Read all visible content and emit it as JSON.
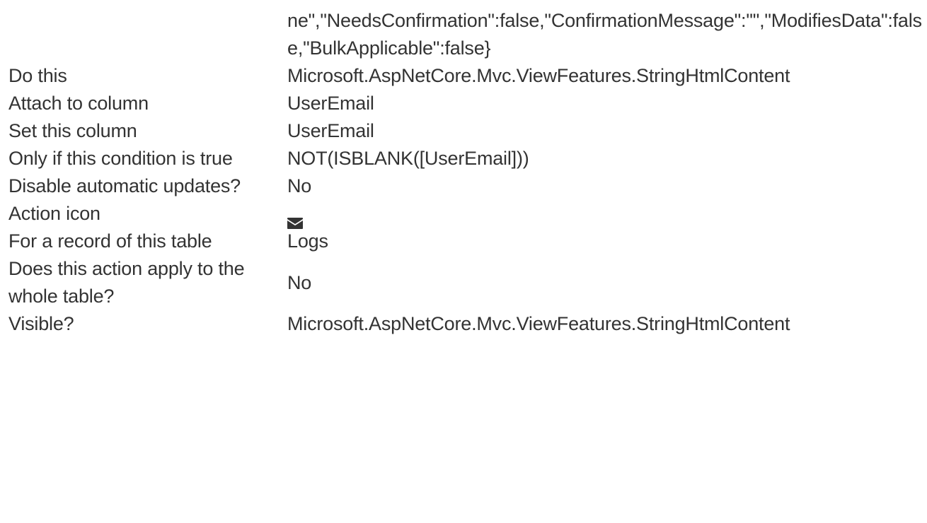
{
  "continuation_value": "ne\",\"NeedsConfirmation\":false,\"ConfirmationMessage\":\"\",\"ModifiesData\":false,\"BulkApplicable\":false}",
  "rows": [
    {
      "label": "Do this",
      "value": "Microsoft.AspNetCore.Mvc.ViewFeatures.StringHtmlContent"
    },
    {
      "label": "Attach to column",
      "value": "UserEmail"
    },
    {
      "label": "Set this column",
      "value": "UserEmail"
    },
    {
      "label": "Only if this condition is true",
      "value": "NOT(ISBLANK([UserEmail]))"
    },
    {
      "label": "Disable automatic updates?",
      "value": "No"
    },
    {
      "label": "Action icon",
      "icon": "envelope-icon"
    },
    {
      "label": "For a record of this table",
      "value": "Logs"
    },
    {
      "label": "Does this action apply to the whole table?",
      "value": "No"
    },
    {
      "label": "Visible?",
      "value": "Microsoft.AspNetCore.Mvc.ViewFeatures.StringHtmlContent"
    }
  ]
}
